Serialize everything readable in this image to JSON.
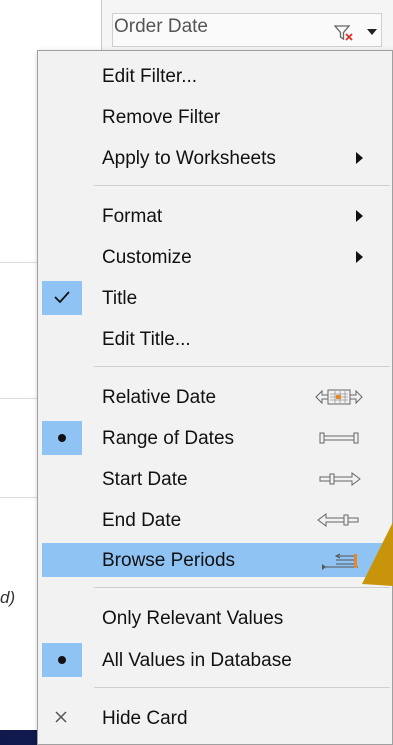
{
  "card": {
    "title": "Order Date"
  },
  "background": {
    "fragment": "d)"
  },
  "menu": {
    "edit_filter": "Edit Filter...",
    "remove_filter": "Remove Filter",
    "apply_to_worksheets": "Apply to Worksheets",
    "format": "Format",
    "customize": "Customize",
    "title": "Title",
    "title_checked": true,
    "edit_title": "Edit Title...",
    "relative_date": "Relative Date",
    "range_of_dates": "Range of Dates",
    "range_of_dates_selected": true,
    "start_date": "Start Date",
    "end_date": "End Date",
    "browse_periods": "Browse Periods",
    "browse_periods_hover": true,
    "only_relevant_values": "Only Relevant Values",
    "all_values_in_database": "All Values in Database",
    "all_values_selected": true,
    "hide_card": "Hide Card"
  },
  "colors": {
    "highlight": "#8fc3f3",
    "accent_orange": "#e8862a",
    "pointer_gold": "#c8940a",
    "background_blue": "#14205c"
  }
}
